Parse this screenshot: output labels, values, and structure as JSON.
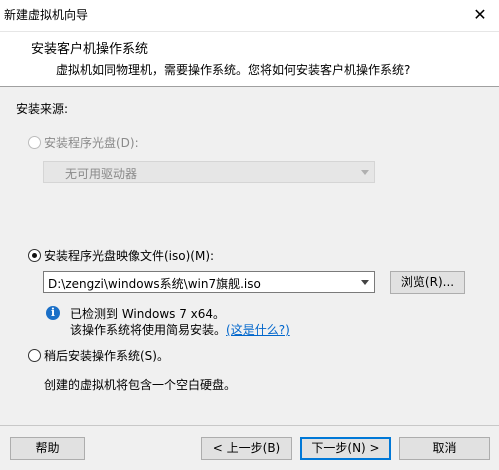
{
  "window": {
    "title": "新建虚拟机向导"
  },
  "header": {
    "title": "安装客户机操作系统",
    "subtitle": "虚拟机如同物理机，需要操作系统。您将如何安装客户机操作系统?"
  },
  "source": {
    "label": "安装来源:",
    "disc": {
      "label": "安装程序光盘(D):",
      "checked": false,
      "disabled": true,
      "drive_value": "无可用驱动器"
    },
    "iso": {
      "label": "安装程序光盘映像文件(iso)(M):",
      "checked": true,
      "path": "D:\\zengzi\\windows系统\\win7旗舰.iso",
      "browse_label": "浏览(R)...",
      "detected": "已检测到 Windows 7 x64。",
      "easy_install": "该操作系统将使用简易安装。",
      "whats_this": "(这是什么?)"
    },
    "later": {
      "label": "稍后安装操作系统(S)。",
      "checked": false,
      "description": "创建的虚拟机将包含一个空白硬盘。"
    }
  },
  "footer": {
    "help": "帮助",
    "back": "< 上一步(B)",
    "next": "下一步(N) >",
    "cancel": "取消"
  }
}
